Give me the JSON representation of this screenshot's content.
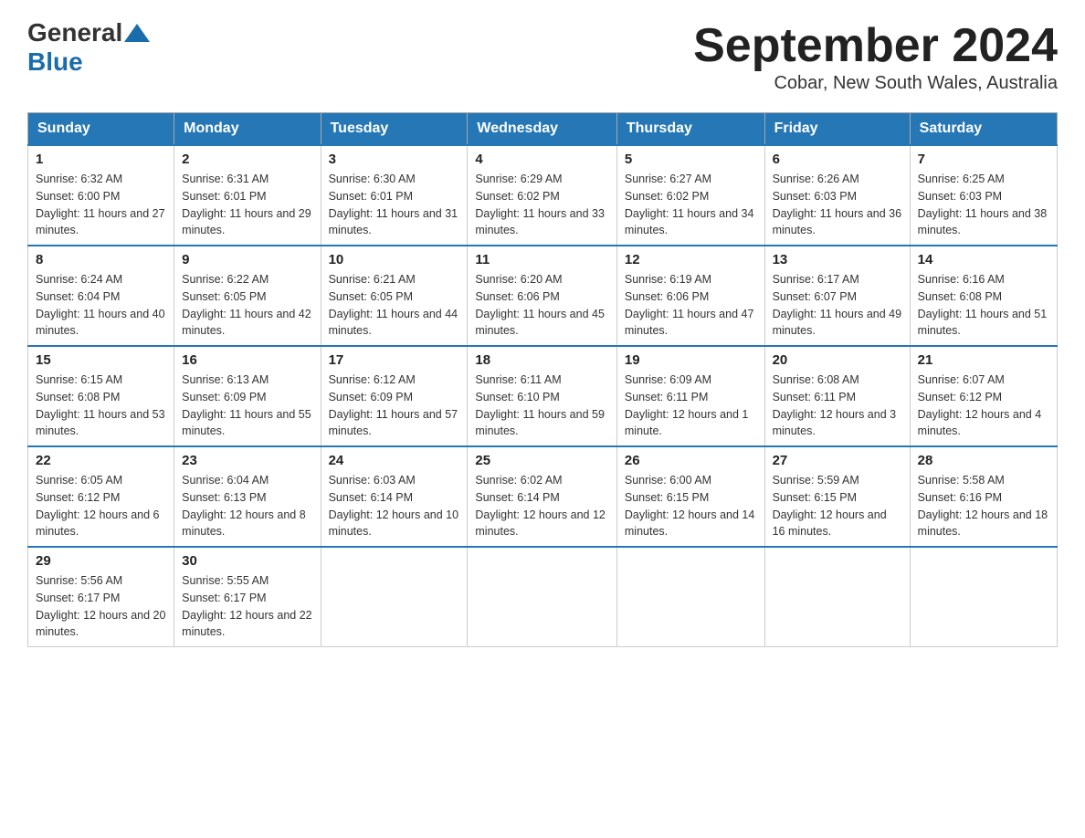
{
  "header": {
    "logo": {
      "text1": "General",
      "text2": "Blue"
    },
    "title": "September 2024",
    "subtitle": "Cobar, New South Wales, Australia"
  },
  "days_of_week": [
    "Sunday",
    "Monday",
    "Tuesday",
    "Wednesday",
    "Thursday",
    "Friday",
    "Saturday"
  ],
  "weeks": [
    [
      {
        "day": "1",
        "sunrise": "6:32 AM",
        "sunset": "6:00 PM",
        "daylight": "11 hours and 27 minutes."
      },
      {
        "day": "2",
        "sunrise": "6:31 AM",
        "sunset": "6:01 PM",
        "daylight": "11 hours and 29 minutes."
      },
      {
        "day": "3",
        "sunrise": "6:30 AM",
        "sunset": "6:01 PM",
        "daylight": "11 hours and 31 minutes."
      },
      {
        "day": "4",
        "sunrise": "6:29 AM",
        "sunset": "6:02 PM",
        "daylight": "11 hours and 33 minutes."
      },
      {
        "day": "5",
        "sunrise": "6:27 AM",
        "sunset": "6:02 PM",
        "daylight": "11 hours and 34 minutes."
      },
      {
        "day": "6",
        "sunrise": "6:26 AM",
        "sunset": "6:03 PM",
        "daylight": "11 hours and 36 minutes."
      },
      {
        "day": "7",
        "sunrise": "6:25 AM",
        "sunset": "6:03 PM",
        "daylight": "11 hours and 38 minutes."
      }
    ],
    [
      {
        "day": "8",
        "sunrise": "6:24 AM",
        "sunset": "6:04 PM",
        "daylight": "11 hours and 40 minutes."
      },
      {
        "day": "9",
        "sunrise": "6:22 AM",
        "sunset": "6:05 PM",
        "daylight": "11 hours and 42 minutes."
      },
      {
        "day": "10",
        "sunrise": "6:21 AM",
        "sunset": "6:05 PM",
        "daylight": "11 hours and 44 minutes."
      },
      {
        "day": "11",
        "sunrise": "6:20 AM",
        "sunset": "6:06 PM",
        "daylight": "11 hours and 45 minutes."
      },
      {
        "day": "12",
        "sunrise": "6:19 AM",
        "sunset": "6:06 PM",
        "daylight": "11 hours and 47 minutes."
      },
      {
        "day": "13",
        "sunrise": "6:17 AM",
        "sunset": "6:07 PM",
        "daylight": "11 hours and 49 minutes."
      },
      {
        "day": "14",
        "sunrise": "6:16 AM",
        "sunset": "6:08 PM",
        "daylight": "11 hours and 51 minutes."
      }
    ],
    [
      {
        "day": "15",
        "sunrise": "6:15 AM",
        "sunset": "6:08 PM",
        "daylight": "11 hours and 53 minutes."
      },
      {
        "day": "16",
        "sunrise": "6:13 AM",
        "sunset": "6:09 PM",
        "daylight": "11 hours and 55 minutes."
      },
      {
        "day": "17",
        "sunrise": "6:12 AM",
        "sunset": "6:09 PM",
        "daylight": "11 hours and 57 minutes."
      },
      {
        "day": "18",
        "sunrise": "6:11 AM",
        "sunset": "6:10 PM",
        "daylight": "11 hours and 59 minutes."
      },
      {
        "day": "19",
        "sunrise": "6:09 AM",
        "sunset": "6:11 PM",
        "daylight": "12 hours and 1 minute."
      },
      {
        "day": "20",
        "sunrise": "6:08 AM",
        "sunset": "6:11 PM",
        "daylight": "12 hours and 3 minutes."
      },
      {
        "day": "21",
        "sunrise": "6:07 AM",
        "sunset": "6:12 PM",
        "daylight": "12 hours and 4 minutes."
      }
    ],
    [
      {
        "day": "22",
        "sunrise": "6:05 AM",
        "sunset": "6:12 PM",
        "daylight": "12 hours and 6 minutes."
      },
      {
        "day": "23",
        "sunrise": "6:04 AM",
        "sunset": "6:13 PM",
        "daylight": "12 hours and 8 minutes."
      },
      {
        "day": "24",
        "sunrise": "6:03 AM",
        "sunset": "6:14 PM",
        "daylight": "12 hours and 10 minutes."
      },
      {
        "day": "25",
        "sunrise": "6:02 AM",
        "sunset": "6:14 PM",
        "daylight": "12 hours and 12 minutes."
      },
      {
        "day": "26",
        "sunrise": "6:00 AM",
        "sunset": "6:15 PM",
        "daylight": "12 hours and 14 minutes."
      },
      {
        "day": "27",
        "sunrise": "5:59 AM",
        "sunset": "6:15 PM",
        "daylight": "12 hours and 16 minutes."
      },
      {
        "day": "28",
        "sunrise": "5:58 AM",
        "sunset": "6:16 PM",
        "daylight": "12 hours and 18 minutes."
      }
    ],
    [
      {
        "day": "29",
        "sunrise": "5:56 AM",
        "sunset": "6:17 PM",
        "daylight": "12 hours and 20 minutes."
      },
      {
        "day": "30",
        "sunrise": "5:55 AM",
        "sunset": "6:17 PM",
        "daylight": "12 hours and 22 minutes."
      },
      null,
      null,
      null,
      null,
      null
    ]
  ]
}
